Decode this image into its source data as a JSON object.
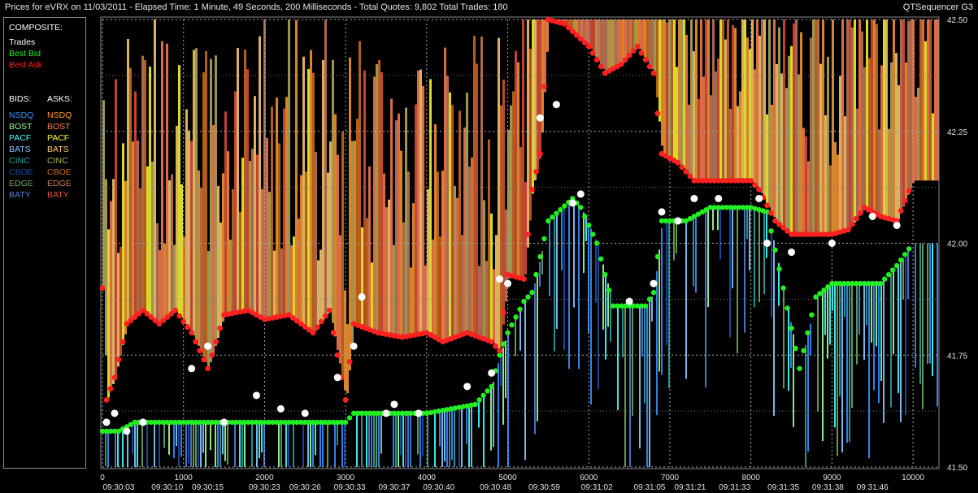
{
  "window": {
    "title": "Prices for  eVRX  on  11/03/2011  -  Elapsed Time: 1 Minute, 49 Seconds, 200 Milliseconds  -  Total Quotes: 9,802  Total Trades: 180",
    "app": "QTSequencer G3"
  },
  "legend": {
    "composite_header": "COMPOSITE:",
    "composite": [
      {
        "label": "Trades",
        "color": "#ffffff"
      },
      {
        "label": "Best Bid",
        "color": "#22ee22"
      },
      {
        "label": "Best Ask",
        "color": "#ff2020"
      }
    ],
    "bids_header": "BIDS:",
    "asks_header": "ASKS:",
    "exchanges": [
      {
        "bid": "NSDQ",
        "ask": "NSDQ",
        "bid_color": "#3a8fff",
        "ask_color": "#ff9a30"
      },
      {
        "bid": "BOST",
        "ask": "BOST",
        "bid_color": "#9dff9d",
        "ask_color": "#ff7f50"
      },
      {
        "bid": "PACF",
        "ask": "PACF",
        "bid_color": "#40ffff",
        "ask_color": "#ffff30"
      },
      {
        "bid": "BATS",
        "ask": "BATS",
        "bid_color": "#88c8ff",
        "ask_color": "#ffd070"
      },
      {
        "bid": "CINC",
        "ask": "CINC",
        "bid_color": "#2aa0a0",
        "ask_color": "#b8b060"
      },
      {
        "bid": "CBOE",
        "ask": "CBOE",
        "bid_color": "#1f4fa0",
        "ask_color": "#d07020"
      },
      {
        "bid": "EDGE",
        "ask": "EDGE",
        "bid_color": "#6aaa5a",
        "ask_color": "#c87a5a"
      },
      {
        "bid": "BATY",
        "ask": "BATY",
        "bid_color": "#5080d8",
        "ask_color": "#e0503a"
      }
    ]
  },
  "chart_data": {
    "type": "scatter",
    "ylim": [
      41.5,
      42.5
    ],
    "xlim": [
      0,
      10300
    ],
    "y_ticks": [
      "42.50",
      "42.25",
      "42.00",
      "41.75",
      "41.50"
    ],
    "x_ticks": [
      {
        "x": 0,
        "label": "0"
      },
      {
        "x": 1000,
        "label": "1000"
      },
      {
        "x": 2000,
        "label": "2000"
      },
      {
        "x": 3000,
        "label": "3000"
      },
      {
        "x": 4000,
        "label": "4000"
      },
      {
        "x": 5000,
        "label": "5000"
      },
      {
        "x": 6000,
        "label": "6000"
      },
      {
        "x": 7000,
        "label": "7000"
      },
      {
        "x": 8000,
        "label": "8000"
      },
      {
        "x": 9000,
        "label": "9000"
      },
      {
        "x": 10000,
        "label": "10000"
      }
    ],
    "time_labels": [
      {
        "x": 200,
        "label": "09:30:03"
      },
      {
        "x": 800,
        "label": "09:30:10"
      },
      {
        "x": 1300,
        "label": "09:30:15"
      },
      {
        "x": 2000,
        "label": "09:30:23"
      },
      {
        "x": 2500,
        "label": "09:30:26"
      },
      {
        "x": 3050,
        "label": "09:30:33"
      },
      {
        "x": 3600,
        "label": "09:30:37"
      },
      {
        "x": 4150,
        "label": "09:30:40"
      },
      {
        "x": 4850,
        "label": "09:30:48"
      },
      {
        "x": 5450,
        "label": "09:30:59"
      },
      {
        "x": 6100,
        "label": "09:31:02"
      },
      {
        "x": 6750,
        "label": "09:31:05"
      },
      {
        "x": 7250,
        "label": "09:31:21"
      },
      {
        "x": 7800,
        "label": "09:31:33"
      },
      {
        "x": 8400,
        "label": "09:31:35"
      },
      {
        "x": 8950,
        "label": "09:31:38"
      },
      {
        "x": 9500,
        "label": "09:31:46"
      }
    ],
    "best_ask": [
      [
        0,
        41.9
      ],
      [
        50,
        41.65
      ],
      [
        150,
        41.7
      ],
      [
        300,
        41.82
      ],
      [
        500,
        41.85
      ],
      [
        700,
        41.82
      ],
      [
        900,
        41.85
      ],
      [
        1100,
        41.8
      ],
      [
        1300,
        41.72
      ],
      [
        1500,
        41.84
      ],
      [
        1800,
        41.85
      ],
      [
        2000,
        41.83
      ],
      [
        2300,
        41.84
      ],
      [
        2600,
        41.8
      ],
      [
        2800,
        41.85
      ],
      [
        3000,
        41.65
      ],
      [
        3100,
        41.82
      ],
      [
        3400,
        41.8
      ],
      [
        3700,
        41.79
      ],
      [
        4000,
        41.8
      ],
      [
        4200,
        41.78
      ],
      [
        4500,
        41.8
      ],
      [
        4800,
        41.78
      ],
      [
        4900,
        41.76
      ],
      [
        5000,
        41.93
      ],
      [
        5200,
        41.92
      ],
      [
        5300,
        42.12
      ],
      [
        5400,
        42.2
      ],
      [
        5500,
        42.5
      ],
      [
        5700,
        42.49
      ],
      [
        6000,
        42.44
      ],
      [
        6200,
        42.38
      ],
      [
        6400,
        42.4
      ],
      [
        6600,
        42.44
      ],
      [
        6800,
        42.38
      ],
      [
        6900,
        42.2
      ],
      [
        7100,
        42.18
      ],
      [
        7300,
        42.14
      ],
      [
        7500,
        42.14
      ],
      [
        7800,
        42.14
      ],
      [
        8000,
        42.14
      ],
      [
        8100,
        42.12
      ],
      [
        8300,
        42.05
      ],
      [
        8500,
        42.02
      ],
      [
        8700,
        42.02
      ],
      [
        9000,
        42.02
      ],
      [
        9200,
        42.03
      ],
      [
        9400,
        42.08
      ],
      [
        9600,
        42.06
      ],
      [
        9800,
        42.05
      ],
      [
        10000,
        42.14
      ]
    ],
    "best_bid": [
      [
        0,
        41.58
      ],
      [
        200,
        41.58
      ],
      [
        400,
        41.6
      ],
      [
        700,
        41.6
      ],
      [
        1000,
        41.6
      ],
      [
        1500,
        41.6
      ],
      [
        2000,
        41.6
      ],
      [
        2500,
        41.6
      ],
      [
        3000,
        41.6
      ],
      [
        3100,
        41.62
      ],
      [
        3500,
        41.62
      ],
      [
        4000,
        41.62
      ],
      [
        4300,
        41.63
      ],
      [
        4600,
        41.64
      ],
      [
        4800,
        41.68
      ],
      [
        4900,
        41.75
      ],
      [
        5000,
        41.8
      ],
      [
        5200,
        41.87
      ],
      [
        5300,
        41.89
      ],
      [
        5500,
        42.05
      ],
      [
        5800,
        42.1
      ],
      [
        5900,
        42.08
      ],
      [
        6100,
        42.0
      ],
      [
        6300,
        41.86
      ],
      [
        6500,
        41.86
      ],
      [
        6700,
        41.86
      ],
      [
        6800,
        41.89
      ],
      [
        6900,
        42.05
      ],
      [
        7000,
        42.05
      ],
      [
        7200,
        42.05
      ],
      [
        7500,
        42.08
      ],
      [
        7800,
        42.08
      ],
      [
        8000,
        42.08
      ],
      [
        8200,
        42.07
      ],
      [
        8400,
        41.9
      ],
      [
        8600,
        41.72
      ],
      [
        8800,
        41.88
      ],
      [
        9000,
        41.91
      ],
      [
        9300,
        41.91
      ],
      [
        9600,
        41.91
      ],
      [
        9800,
        41.95
      ],
      [
        10000,
        42.0
      ]
    ],
    "trades": [
      [
        50,
        41.6
      ],
      [
        150,
        41.62
      ],
      [
        300,
        41.58
      ],
      [
        500,
        41.6
      ],
      [
        1100,
        41.72
      ],
      [
        1300,
        41.77
      ],
      [
        1500,
        41.6
      ],
      [
        1900,
        41.66
      ],
      [
        2200,
        41.63
      ],
      [
        2500,
        41.62
      ],
      [
        2900,
        41.7
      ],
      [
        3100,
        41.77
      ],
      [
        3200,
        41.88
      ],
      [
        3500,
        41.62
      ],
      [
        3600,
        41.64
      ],
      [
        3900,
        41.62
      ],
      [
        4500,
        41.68
      ],
      [
        4800,
        41.71
      ],
      [
        4900,
        41.92
      ],
      [
        5000,
        41.91
      ],
      [
        5400,
        42.28
      ],
      [
        5600,
        42.31
      ],
      [
        5800,
        42.09
      ],
      [
        5900,
        42.11
      ],
      [
        6500,
        41.87
      ],
      [
        6800,
        41.91
      ],
      [
        6900,
        42.07
      ],
      [
        7100,
        42.05
      ],
      [
        7300,
        42.1
      ],
      [
        7600,
        42.1
      ],
      [
        8100,
        42.1
      ],
      [
        8200,
        42.0
      ],
      [
        8500,
        41.98
      ],
      [
        9000,
        42.0
      ],
      [
        9500,
        42.06
      ],
      [
        9800,
        42.04
      ]
    ]
  }
}
